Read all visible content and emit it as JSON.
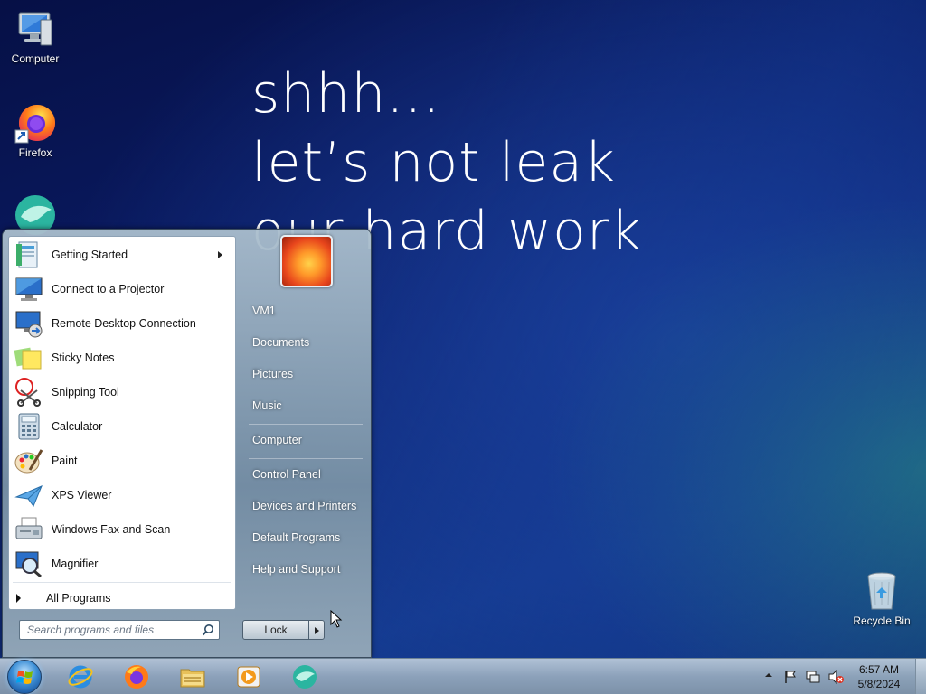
{
  "desktop": {
    "wallpaper_lines": [
      "shhh...",
      "let’s not leak",
      "our hard work"
    ],
    "icons": [
      {
        "label": "Computer",
        "icon": "computer-icon"
      },
      {
        "label": "Firefox",
        "icon": "firefox-icon"
      },
      {
        "label": "",
        "icon": "app-icon"
      },
      {
        "label": "Recycle Bin",
        "icon": "recycle-bin-icon"
      }
    ]
  },
  "start_menu": {
    "programs": [
      {
        "label": "Getting Started",
        "icon": "getting-started-icon",
        "submenu": true
      },
      {
        "label": "Connect to a Projector",
        "icon": "projector-icon"
      },
      {
        "label": "Remote Desktop Connection",
        "icon": "remote-desktop-icon"
      },
      {
        "label": "Sticky Notes",
        "icon": "sticky-notes-icon"
      },
      {
        "label": "Snipping Tool",
        "icon": "snipping-tool-icon"
      },
      {
        "label": "Calculator",
        "icon": "calculator-icon"
      },
      {
        "label": "Paint",
        "icon": "paint-icon"
      },
      {
        "label": "XPS Viewer",
        "icon": "xps-viewer-icon"
      },
      {
        "label": "Windows Fax and Scan",
        "icon": "fax-scan-icon"
      },
      {
        "label": "Magnifier",
        "icon": "magnifier-icon"
      }
    ],
    "all_programs": "All Programs",
    "search_placeholder": "Search programs and files",
    "right_items": [
      "VM1",
      "Documents",
      "Pictures",
      "Music",
      "Computer",
      "Control Panel",
      "Devices and Printers",
      "Default Programs",
      "Help and Support"
    ],
    "lock_label": "Lock"
  },
  "taskbar": {
    "pinned": [
      "internet-explorer-icon",
      "firefox-icon",
      "file-explorer-icon",
      "media-player-icon",
      "app-icon"
    ],
    "tray": [
      "show-hidden-icons-icon",
      "action-center-flag-icon",
      "network-icon",
      "volume-muted-icon"
    ],
    "time": "6:57 AM",
    "date": "5/8/2024"
  },
  "colors": {
    "accent": "#3d8fd6",
    "desktop_bg": "#0b1e6b"
  }
}
